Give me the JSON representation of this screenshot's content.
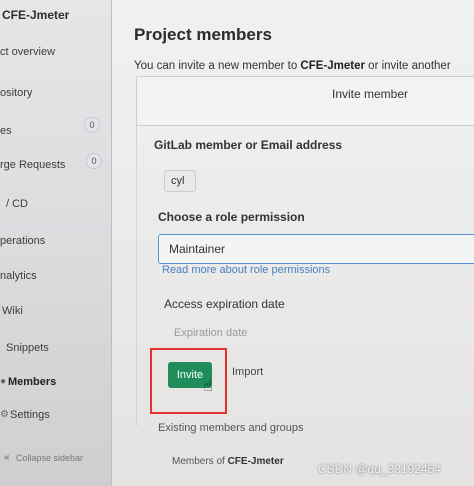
{
  "sidebar": {
    "project": "CFE-Jmeter",
    "items": [
      {
        "label": "ct overview"
      },
      {
        "label": "ository"
      },
      {
        "label": "es",
        "badge": "0"
      },
      {
        "label": "rge Requests",
        "badge": "0"
      },
      {
        "label": "/ CD"
      },
      {
        "label": "perations"
      },
      {
        "label": "nalytics"
      },
      {
        "label": "Wiki"
      },
      {
        "label": "Snippets"
      },
      {
        "label": "Members"
      },
      {
        "label": "Settings"
      },
      {
        "label": "Collapse sidebar"
      }
    ]
  },
  "main": {
    "title": "Project members",
    "subtitle_prefix": "You can invite a new member to ",
    "subtitle_project": "CFE-Jmeter",
    "subtitle_suffix": " or invite another",
    "card_title": "Invite member",
    "member_label": "GitLab member or Email address",
    "member_value": "cyl",
    "role_label": "Choose a role permission",
    "role_value": "Maintainer",
    "role_link": "Read more about role permissions",
    "expiration_label": "Access expiration date",
    "expiration_placeholder": "Expiration date",
    "invite_button": "Invite",
    "import_link": "Import",
    "existing_heading": "Existing members and groups",
    "members_of_prefix": "Members of ",
    "members_of_project": "CFE-Jmeter"
  },
  "watermark": "CSDN @qq_33192454"
}
